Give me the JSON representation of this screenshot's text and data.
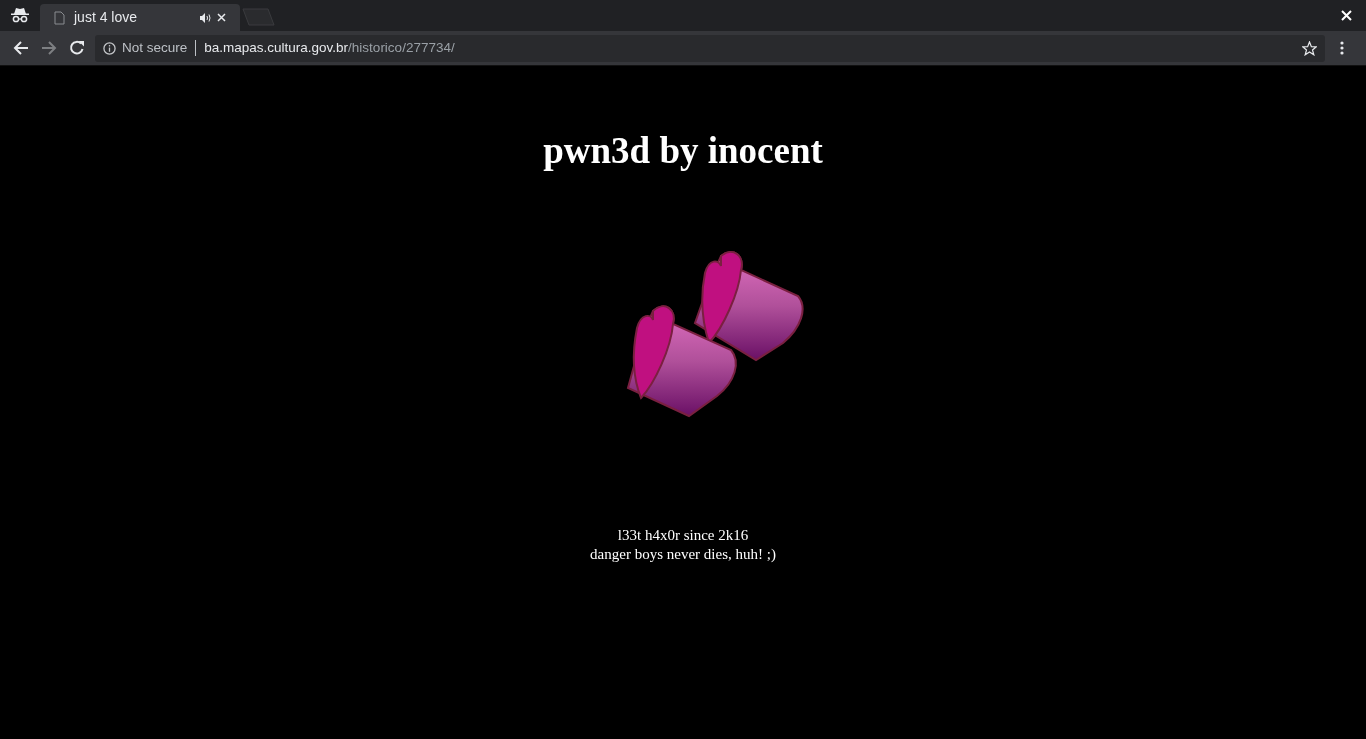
{
  "tabs": [
    {
      "title": "just 4 love",
      "selected": true,
      "audio": true
    }
  ],
  "address_bar": {
    "security": "Not secure",
    "host": "ba.mapas.cultura.gov.br",
    "path": "/historico/277734/"
  },
  "page": {
    "heading": "pwn3d by inocent",
    "lines": [
      "l33t h4x0r since 2k16",
      "danger boys never dies, huh! ;)"
    ]
  }
}
